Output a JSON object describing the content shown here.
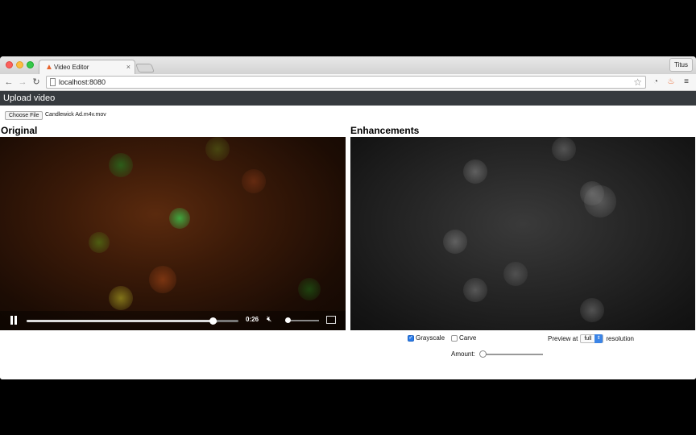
{
  "browser": {
    "tab_title": "Video Editor",
    "profile_name": "Titus",
    "url": "localhost:8080"
  },
  "app": {
    "header_title": "Upload video",
    "choose_file_label": "Choose File",
    "file_name": "Candlewick Ad.m4v.mov",
    "original_title": "Original",
    "enhancements_title": "Enhancements"
  },
  "player": {
    "time": "0:26",
    "progress": 0.88,
    "volume": 0.0
  },
  "options": {
    "grayscale_label": "Grayscale",
    "grayscale_checked": true,
    "carve_label": "Carve",
    "carve_checked": false,
    "preview_label": "Preview at",
    "resolution_value": "full",
    "resolution_suffix": "resolution",
    "amount_label": "Amount:",
    "amount_value": 0
  },
  "colors": {
    "header_bg": "#363a3e",
    "accent": "#2b7ce9"
  }
}
